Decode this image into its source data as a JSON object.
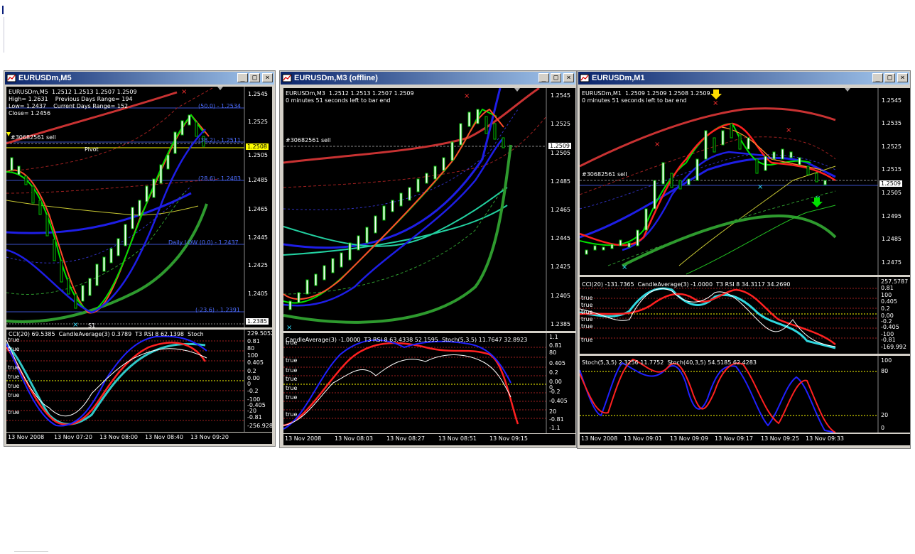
{
  "windows": [
    {
      "title": "EURUSDm,M5",
      "info_lines": [
        "EURUSDm,M5  1.2512 1.2513 1.2507 1.2509",
        "High= 1.2631    Previous Days Range= 194",
        "Low= 1.2437    Current Days Range= 152",
        "Close= 1.2456"
      ],
      "order_label": "#30682561 sell",
      "pivot_label": "Pivot",
      "s1_label": "S1",
      "fib_labels": [
        "(50.0) - 1.2534",
        "(38.2) - 1.2511",
        "(28.6) - 1.2483",
        "Daily LOW (0.0) - 1.2437",
        "(-23.6) - 1.2391"
      ],
      "price_scale": [
        "1.2545",
        "1.2525",
        "1.2505",
        "1.2485",
        "1.2465",
        "1.2445",
        "1.2425",
        "1.2405",
        "1.2385"
      ],
      "current_price": "1.2508",
      "indicator_label": "CCI(20) 69.5385  CandleAverage(3) 0.3789  T3 RSI 8 62.1398  Stoch",
      "indicator_scale": [
        "229.5052",
        "0.81",
        "80",
        "100",
        "0.405",
        "0.2",
        "0.00",
        "0",
        "-0.2",
        "-100",
        "-0.405",
        "-20",
        "-0.81",
        "-256.928"
      ],
      "true_labels": [
        "true",
        "true",
        "true",
        "true",
        "true",
        "true",
        "true"
      ],
      "time_labels": [
        "13 Nov 2008",
        "13 Nov 07:20",
        "13 Nov 08:00",
        "13 Nov 08:40",
        "13 Nov 09:20"
      ]
    },
    {
      "title": "EURUSDm,M3 (offline)",
      "info_lines": [
        "EURUSDm,M3  1.2512 1.2513 1.2507 1.2509",
        "0 minutes 51 seconds left to bar end"
      ],
      "order_label": "#30682561 sell",
      "price_scale": [
        "1.2545",
        "1.2525",
        "1.2505",
        "1.2485",
        "1.2465",
        "1.2445",
        "1.2425",
        "1.2405",
        "1.2385"
      ],
      "current_price": "1.2509",
      "indicator_label": "CandleAverage(3) -1.0000  T3 RSI 8 63.4338 52.1595  Stoch(5,3,5) 11.7647 32.8923",
      "indicator_scale": [
        "1.1",
        "0.81",
        "80",
        "0.405",
        "0.2",
        "0.00",
        "0",
        "-0.2",
        "-0.405",
        "20",
        "-0.81",
        "-1.1"
      ],
      "true_labels": [
        "true",
        "true",
        "true",
        "true",
        "true",
        "true",
        "true"
      ],
      "time_labels": [
        "13 Nov 2008",
        "13 Nov 08:03",
        "13 Nov 08:27",
        "13 Nov 08:51",
        "13 Nov 09:15"
      ]
    },
    {
      "title": "EURUSDm,M1",
      "info_lines": [
        "EURUSDm,M1  1.2509 1.2509 1.2508 1.2509",
        "0 minutes 51 seconds left to bar end"
      ],
      "order_label": "#30682561 sell",
      "price_scale": [
        "1.2545",
        "1.2535",
        "1.2525",
        "1.2515",
        "1.2505",
        "1.2495",
        "1.2485",
        "1.2475"
      ],
      "current_price": "1.2509",
      "indicator_label": "CCI(20) -131.7365  CandleAverage(3) -1.0000  T3 RSI 8 34.3117 34.2690",
      "indicator_scale": [
        "257.5787",
        "0.81",
        "100",
        "0.405",
        "0.2",
        "0.00",
        "-0.2",
        "-0.405",
        "-100",
        "-0.81",
        "-169.992"
      ],
      "true_labels": [
        "true",
        "true",
        "true",
        "true",
        "true",
        "true"
      ],
      "stoch_label": "Stoch(5,3,5) 2.3256 11.7752  Stoch(40,3,5) 54.5185 62.4283",
      "stoch_scale": [
        "100",
        "80",
        "20",
        "0"
      ],
      "time_labels": [
        "13 Nov 2008",
        "13 Nov 09:01",
        "13 Nov 09:09",
        "13 Nov 09:17",
        "13 Nov 09:25",
        "13 Nov 09:33"
      ]
    }
  ],
  "colors": {
    "titlebar_start": "#0a246a",
    "titlebar_end": "#a6caf0",
    "chart_bg": "#000000",
    "bull_candle": "#ffffff",
    "bear_candle": "#00c000",
    "band_red": "#c83232",
    "band_blue": "#1e1ee6",
    "band_green": "#2e9a2e",
    "price_tag": "#ffff00"
  }
}
